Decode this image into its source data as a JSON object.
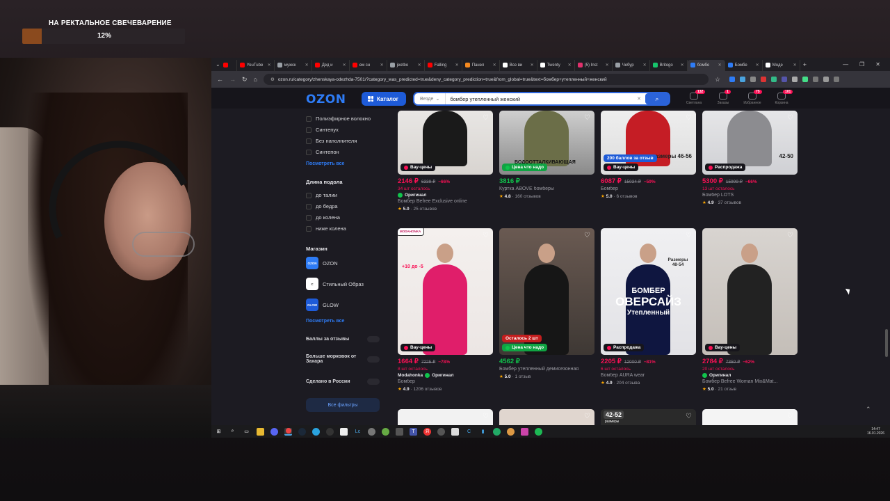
{
  "overlay": {
    "goal_title": "НА РЕКТАЛЬНОЕ СВЕЧЕВАРЕНИЕ",
    "goal_progress": 0.12,
    "goal_percent_label": "12%"
  },
  "browser": {
    "tabs": [
      {
        "label": "",
        "color": "#ff0000"
      },
      {
        "label": "YouTube",
        "color": "#ff0000"
      },
      {
        "label": "мужск",
        "color": "#9aa0a6"
      },
      {
        "label": "Дед и",
        "color": "#ff0000"
      },
      {
        "label": "ем сн",
        "color": "#ff0000"
      },
      {
        "label": "jeetbo",
        "color": "#9aa0a6"
      },
      {
        "label": "Falling",
        "color": "#ff0000"
      },
      {
        "label": "Панел",
        "color": "#f58a1f"
      },
      {
        "label": "Все ви",
        "color": "#ffffff"
      },
      {
        "label": "Twenty",
        "color": "#ffffff"
      },
      {
        "label": "(5) Inst",
        "color": "#e1306c"
      },
      {
        "label": "Чебур",
        "color": "#9aa0a6"
      },
      {
        "label": "Britogo",
        "color": "#16c46b"
      },
      {
        "label": "бомбе",
        "color": "#2e7cf6",
        "active": true
      },
      {
        "label": "Бомбе",
        "color": "#2e7cf6"
      },
      {
        "label": "Моде",
        "color": "#ffffff"
      }
    ],
    "url": "ozon.ru/category/zhenskaya-odezhda-7501/?category_was_predicted=true&deny_category_prediction=true&from_global=true&text=бомбер+утепленный+женский"
  },
  "ozon": {
    "logo": "OZON",
    "catalog_label": "Каталог",
    "search_scope": "Везде",
    "search_query": "бомбер утепленный женский",
    "header_icons": [
      {
        "label": "Светлана",
        "badge": "132",
        "icon": "user-icon"
      },
      {
        "label": "Заказы",
        "badge": "1",
        "icon": "box-icon"
      },
      {
        "label": "Избранное",
        "badge": "75",
        "icon": "heart-icon"
      },
      {
        "label": "Корзина",
        "badge": "101",
        "icon": "cart-icon"
      }
    ]
  },
  "sidebar": {
    "fill_items": [
      "Полиэфирное волокно",
      "Синтепух",
      "Без наполнителя",
      "Синтепон"
    ],
    "see_all_1": "Посмотреть все",
    "length_title": "Длина подола",
    "length_items": [
      "до талии",
      "до бедра",
      "до колена",
      "ниже колена"
    ],
    "shop_title": "Магазин",
    "shops": [
      {
        "name": "OZON",
        "logo": "OZON",
        "color": "#2e7cf6"
      },
      {
        "name": "Стильный Образ",
        "logo": "C",
        "color": "#ffffff"
      },
      {
        "name": "GLOW",
        "logo": "GLOW",
        "color": "#1e5bd8"
      }
    ],
    "see_all_2": "Посмотреть все",
    "toggles": [
      "Баллы за отзывы",
      "Больше морковок от Захара",
      "Сделано в России"
    ],
    "all_filters": "Все фильтры"
  },
  "products_row1": [
    {
      "tag": "Вау-цены",
      "tag_color": "#f91155",
      "price": "2146 ₽",
      "old": "6339 ₽",
      "disc": "−66%",
      "left": "34 шт осталось",
      "original": "Оригинал",
      "name": "Бомбер Befree Exclusive online",
      "rating": "5.0",
      "reviews": "25 отзывов",
      "green": false
    },
    {
      "tag": "Цена что надо",
      "tag_color": "#10c44c",
      "price": "3816 ₽",
      "old": "",
      "disc": "",
      "left": "",
      "original": "",
      "name": "Куртка ABOVE бомберы",
      "rating": "4.8",
      "reviews": "160 отзывов",
      "green": true,
      "overlay_text": "ВОДООТТАЛКИВАЮЩАЯ"
    },
    {
      "tag": "Вау-цены",
      "tag_color": "#f91155",
      "badge": "200 баллов за отзыв",
      "price": "6087 ₽",
      "old": "15034 ₽",
      "disc": "−59%",
      "left": "",
      "original": "",
      "name": "Бомбер",
      "rating": "5.0",
      "reviews": "6 отзывов",
      "green": false,
      "overlay_text": "размеры 46-56"
    },
    {
      "tag": "Распродажа",
      "tag_color": "#f91155",
      "price": "5300 ₽",
      "old": "15999 ₽",
      "disc": "−66%",
      "left": "13 шт осталось",
      "original": "",
      "name": "Бомбер LOTS",
      "rating": "4.9",
      "reviews": "37 отзывов",
      "green": false,
      "overlay_text": "42-50"
    }
  ],
  "products_row2": [
    {
      "tag": "Вау-цены",
      "tag_color": "#f91155",
      "price": "1664 ₽",
      "old": "7225 ₽",
      "disc": "−78%",
      "left": "8 шт осталось",
      "brand": "Modahonka",
      "original": "Оригинал",
      "name": "Бомбер",
      "rating": "4.9",
      "reviews": "1206 отзывов",
      "overlay_text": "+10 до -5",
      "logo_text": "MODAHONKA"
    },
    {
      "tag": "Цена что надо",
      "tag_color": "#10c44c",
      "tag2": "Осталось 2 шт",
      "price": "4562 ₽",
      "old": "",
      "disc": "",
      "left": "",
      "original": "",
      "name": "Бомбер утепленный демисезонная",
      "rating": "5.0",
      "reviews": "1 отзыв",
      "green": true
    },
    {
      "tag": "Распродажа",
      "tag_color": "#f91155",
      "price": "2205 ₽",
      "old": "12000 ₽",
      "disc": "−81%",
      "left": "6 шт осталось",
      "original": "",
      "name": "Бомбер AURA wear",
      "rating": "4.9",
      "reviews": "204 отзыва",
      "overlay_small": "Размеры 48-54",
      "overlay_big1": "БОМБЕР",
      "overlay_big2": "ОВЕРСАЙЗ",
      "overlay_big3": "Утепленный"
    },
    {
      "tag": "Вау-цены",
      "tag_color": "#f91155",
      "price": "2784 ₽",
      "old": "7359 ₽",
      "disc": "−62%",
      "left": "20 шт осталось",
      "original": "Оригинал",
      "name": "Бомбер Befree Woman Mix&Mat...",
      "rating": "5.0",
      "reviews": "21 отзыв"
    }
  ],
  "row3_label": "42-52",
  "row3_sub": "размеры",
  "taskbar": {
    "time": "14:47",
    "date": "16.01.2026"
  }
}
